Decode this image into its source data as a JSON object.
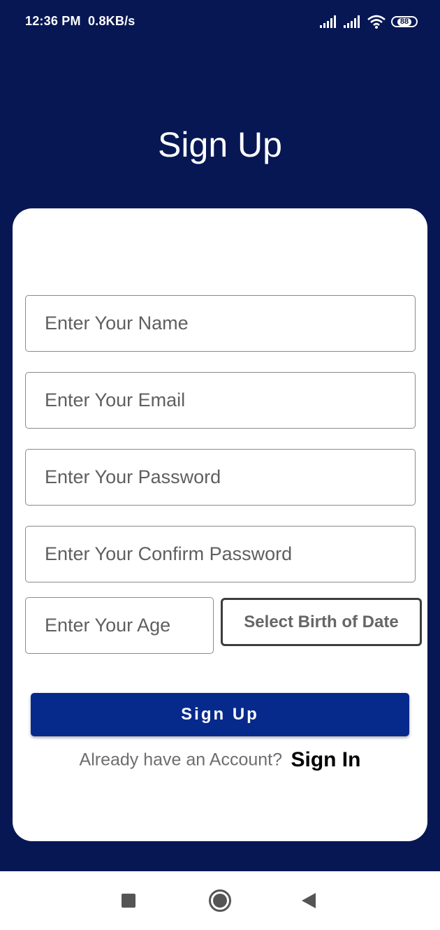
{
  "status_bar": {
    "time": "12:36 PM",
    "net_speed": "0.8KB/s",
    "battery": "88",
    "icons": [
      "signal-icon",
      "signal-icon",
      "wifi-icon",
      "battery-icon"
    ]
  },
  "header": {
    "title": "Sign Up"
  },
  "form": {
    "name_placeholder": "Enter Your Name",
    "email_placeholder": "Enter Your Email",
    "password_placeholder": "Enter Your Password",
    "confirm_password_placeholder": "Enter Your Confirm Password",
    "age_placeholder": "Enter Your Age",
    "dob_button": "Select Birth of Date",
    "submit_button": "Sign Up"
  },
  "footer": {
    "prompt": "Already have an Account?",
    "link": "Sign In"
  },
  "nav_bar": {
    "icons": [
      "recents-icon",
      "home-icon",
      "back-icon"
    ]
  },
  "colors": {
    "background": "#071754",
    "button": "#06298c",
    "card": "#ffffff"
  }
}
